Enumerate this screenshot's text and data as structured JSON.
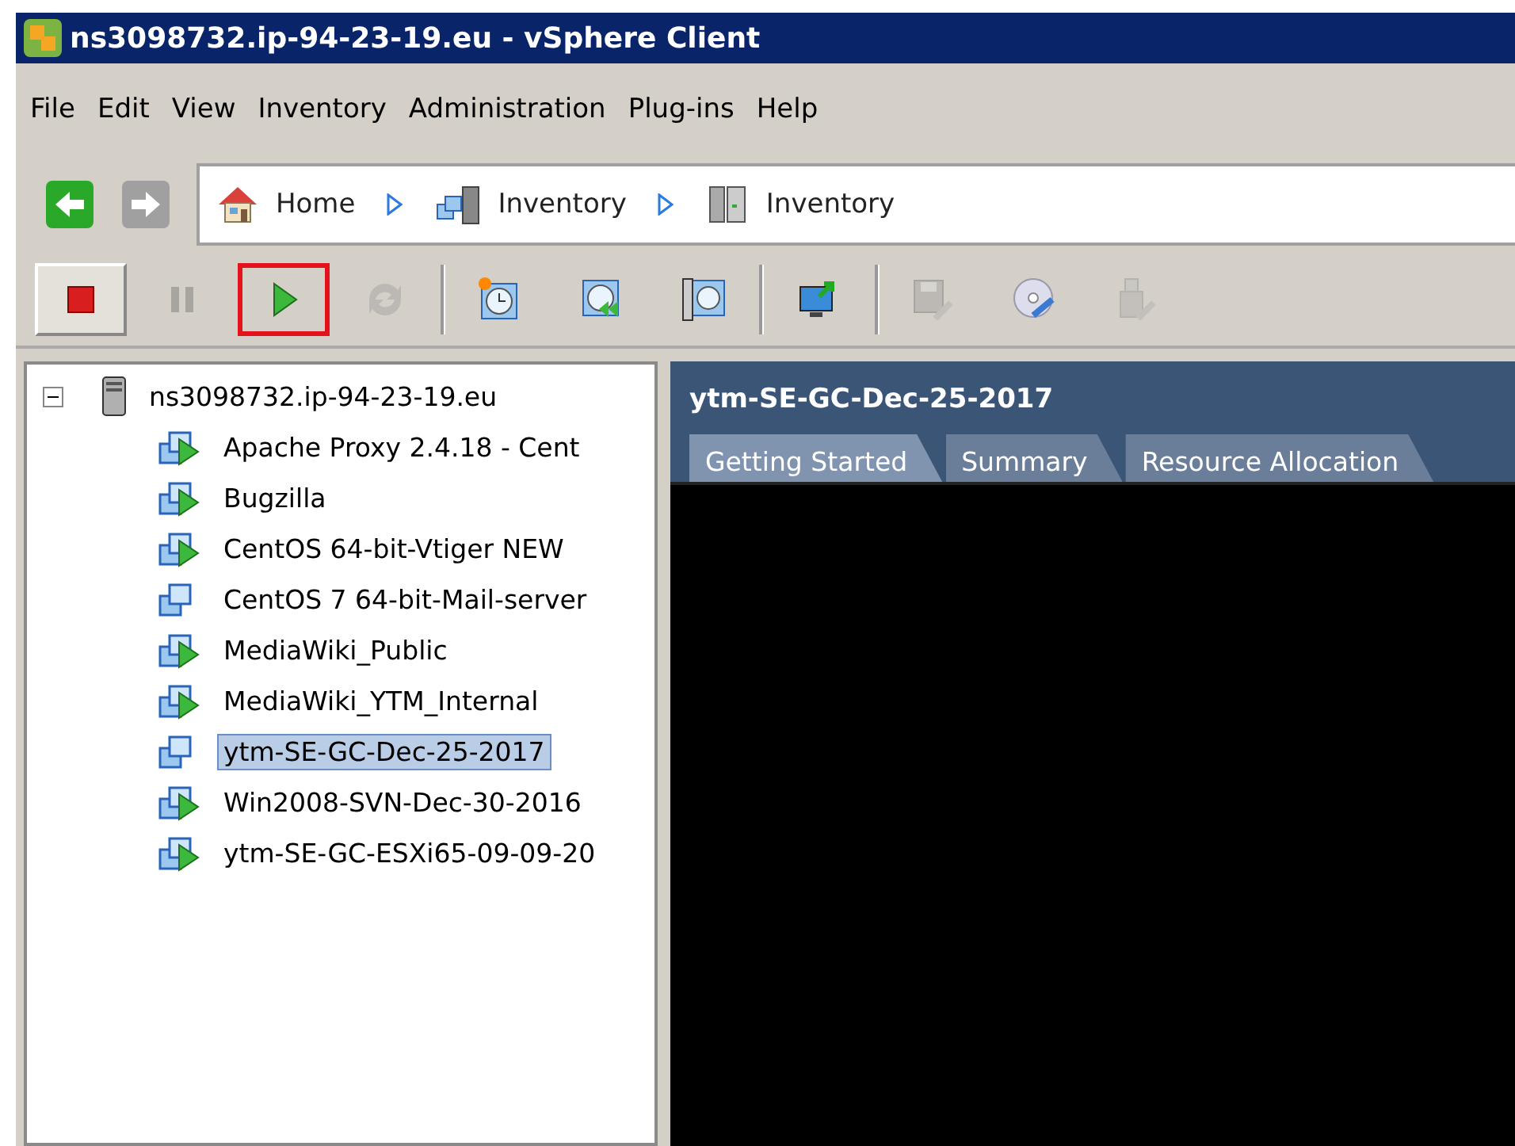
{
  "window": {
    "title": "ns3098732.ip-94-23-19.eu - vSphere Client"
  },
  "menu": [
    "File",
    "Edit",
    "View",
    "Inventory",
    "Administration",
    "Plug-ins",
    "Help"
  ],
  "navigation": {
    "back": {
      "disabled": false
    },
    "forward": {
      "disabled": true
    },
    "breadcrumbs": [
      {
        "label": "Home",
        "kind": "home"
      },
      {
        "label": "Inventory",
        "kind": "inventory"
      },
      {
        "label": "Inventory",
        "kind": "server"
      }
    ]
  },
  "toolbar": [
    {
      "kind": "stop",
      "disabled": false,
      "pressed": true,
      "highlighted": false
    },
    {
      "kind": "pause",
      "disabled": true,
      "pressed": false,
      "highlighted": false
    },
    {
      "kind": "play",
      "disabled": false,
      "pressed": false,
      "highlighted": true
    },
    {
      "kind": "reset",
      "disabled": true,
      "pressed": false,
      "highlighted": false
    },
    {
      "kind": "separator"
    },
    {
      "kind": "snapshot",
      "disabled": false,
      "pressed": false,
      "highlighted": false
    },
    {
      "kind": "revert",
      "disabled": false,
      "pressed": false,
      "highlighted": false
    },
    {
      "kind": "manage",
      "disabled": false,
      "pressed": false,
      "highlighted": false
    },
    {
      "kind": "separator"
    },
    {
      "kind": "console",
      "disabled": false,
      "pressed": false,
      "highlighted": false
    },
    {
      "kind": "separator"
    },
    {
      "kind": "floppy",
      "disabled": true,
      "pressed": false,
      "highlighted": false
    },
    {
      "kind": "cd",
      "disabled": false,
      "pressed": false,
      "highlighted": false
    },
    {
      "kind": "usb",
      "disabled": true,
      "pressed": false,
      "highlighted": false
    }
  ],
  "tree": [
    {
      "label": "ns3098732.ip-94-23-19.eu",
      "kind": "host",
      "expanded": true,
      "selected": false,
      "children": [
        {
          "label": "Apache Proxy 2.4.18 - Cent",
          "kind": "vm_on",
          "selected": false
        },
        {
          "label": "Bugzilla",
          "kind": "vm_on",
          "selected": false
        },
        {
          "label": "CentOS 64-bit-Vtiger NEW",
          "kind": "vm_on",
          "selected": false
        },
        {
          "label": "CentOS 7 64-bit-Mail-server",
          "kind": "vm_off",
          "selected": false
        },
        {
          "label": "MediaWiki_Public",
          "kind": "vm_on",
          "selected": false
        },
        {
          "label": "MediaWiki_YTM_Internal",
          "kind": "vm_on",
          "selected": false
        },
        {
          "label": "ytm-SE-GC-Dec-25-2017",
          "kind": "vm_off",
          "selected": true
        },
        {
          "label": "Win2008-SVN-Dec-30-2016",
          "kind": "vm_on",
          "selected": false
        },
        {
          "label": "ytm-SE-GC-ESXi65-09-09-20",
          "kind": "vm_on",
          "selected": false
        }
      ]
    }
  ],
  "detail": {
    "title": "ytm-SE-GC-Dec-25-2017",
    "tabs": [
      {
        "label": "Getting Started",
        "selected": true
      },
      {
        "label": "Summary",
        "selected": false
      },
      {
        "label": "Resource Allocation",
        "selected": false
      }
    ]
  }
}
